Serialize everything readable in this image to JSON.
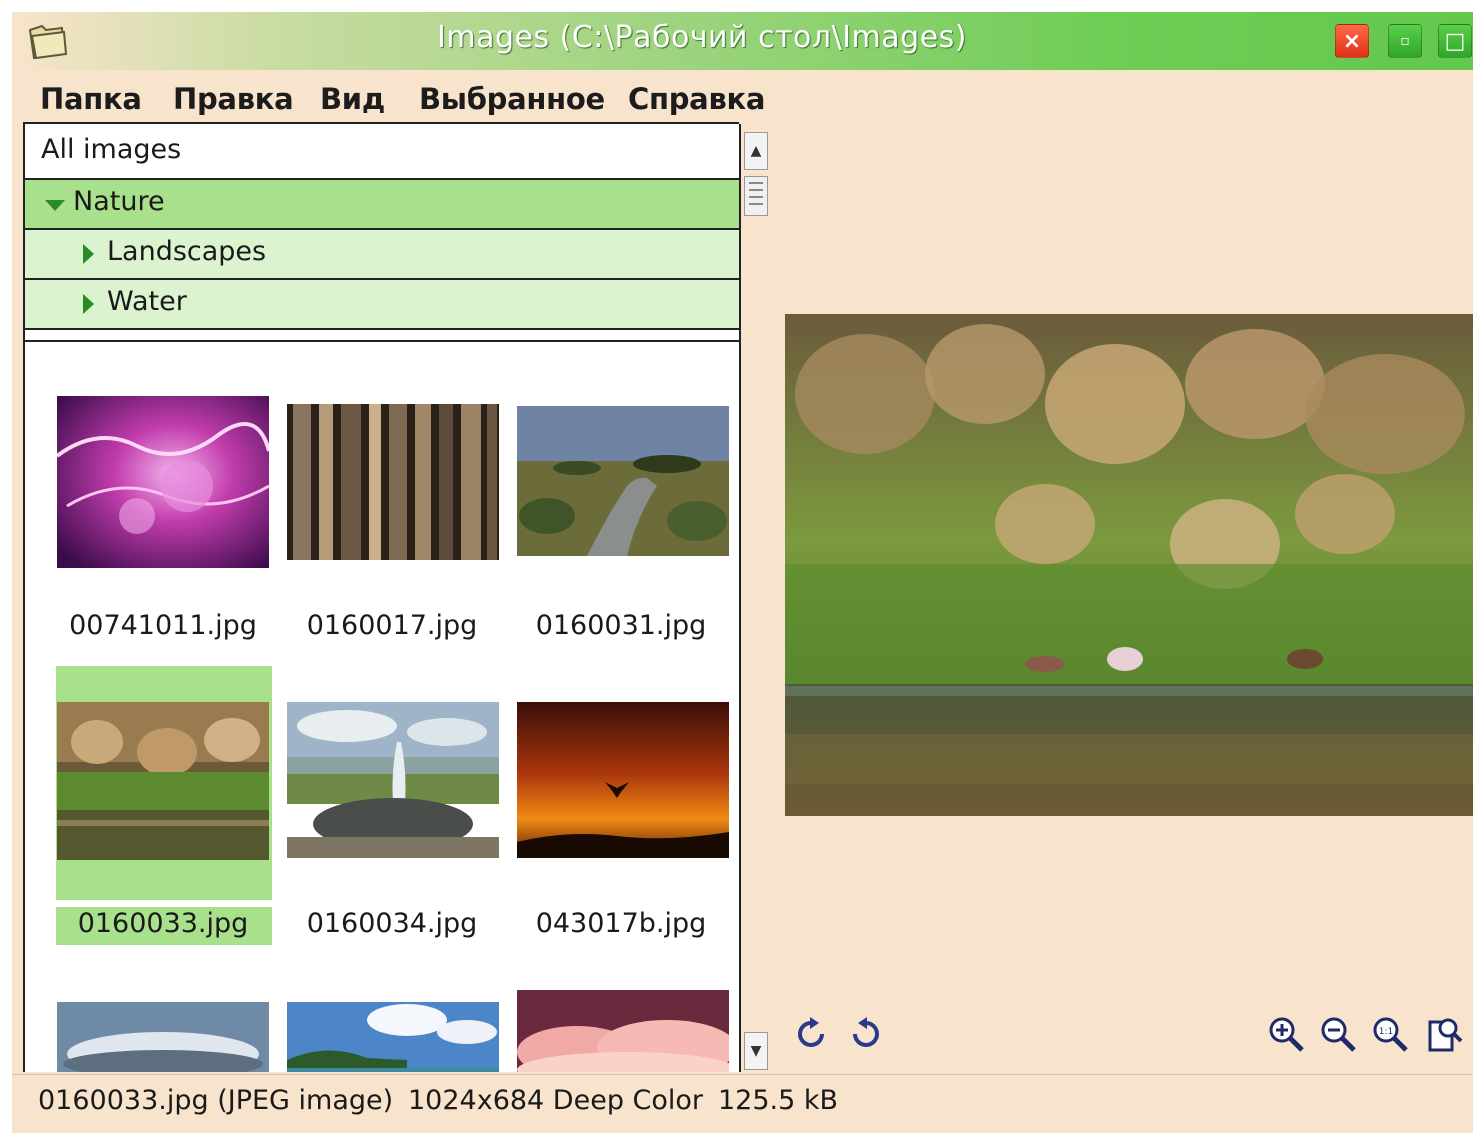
{
  "window": {
    "title": "Images (C:\\Рабочий стол\\Images)",
    "close_label": "×",
    "minimize_label": "▫",
    "maximize_label": "□"
  },
  "menu": {
    "items": [
      {
        "label": "Папка"
      },
      {
        "label": "Правка"
      },
      {
        "label": "Вид"
      },
      {
        "label": "Выбранное"
      },
      {
        "label": "Справка"
      }
    ]
  },
  "tree": {
    "all": "All images",
    "nature": "Nature",
    "landscapes": "Landscapes",
    "water": "Water",
    "expanded_icon": "triangle-down-icon",
    "collapsed_icon": "triangle-right-icon"
  },
  "thumbnails": [
    {
      "name": "00741011.jpg",
      "image": "magenta clouds"
    },
    {
      "name": "0160017.jpg",
      "image": "tree trunks"
    },
    {
      "name": "0160031.jpg",
      "image": "savanna stream"
    },
    {
      "name": "0160033.jpg",
      "image": "grass by water",
      "selected": true
    },
    {
      "name": "0160034.jpg",
      "image": "geyser"
    },
    {
      "name": "043017b.jpg",
      "image": "orange sunset"
    },
    {
      "name": "",
      "image": "storm cloud"
    },
    {
      "name": "",
      "image": "tropical island"
    },
    {
      "name": "",
      "image": "pink clouds"
    }
  ],
  "toolbar": {
    "rotate_cw_icon": "rotate-clockwise-icon",
    "rotate_ccw_icon": "rotate-counterclockwise-icon",
    "zoom_in_icon": "zoom-in-icon",
    "zoom_out_icon": "zoom-out-icon",
    "zoom_actual_icon": "zoom-100-icon",
    "fit_icon": "fit-window-icon",
    "zoom_actual_label": "1:1"
  },
  "status": {
    "file": "0160033.jpg (JPEG image)",
    "dimensions": "1024x684 Deep Color",
    "size": "125.5 kB"
  },
  "colors": {
    "window_bg": "#f8e4cc",
    "selection": "#a9e08c",
    "title_accent": "#64c74e",
    "close_red": "#e0301a"
  }
}
